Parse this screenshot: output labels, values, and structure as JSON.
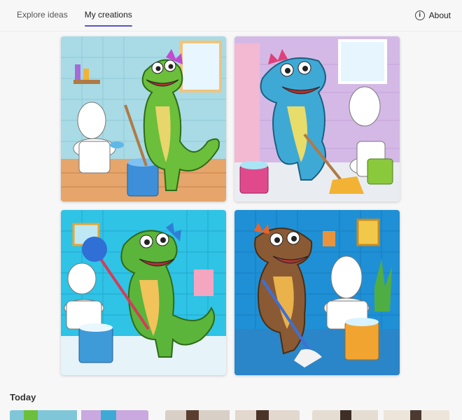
{
  "nav": {
    "tabs": [
      {
        "label": "Explore ideas",
        "active": false
      },
      {
        "label": "My creations",
        "active": true
      }
    ],
    "about_label": "About",
    "about_icon": "info-icon"
  },
  "creations": [
    {
      "subject": "green dinosaur mopping bathroom",
      "accent": "#6bbf3a"
    },
    {
      "subject": "blue dinosaur mopping bathroom",
      "accent": "#3fa9d6"
    },
    {
      "subject": "green dinosaur with duster",
      "accent": "#5bb53a"
    },
    {
      "subject": "brown dinosaur mopping bathroom",
      "accent": "#8a5a35"
    }
  ],
  "history": {
    "section_title": "Today"
  },
  "colors": {
    "accent": "#5a55c9",
    "background": "#f7f7f8"
  }
}
